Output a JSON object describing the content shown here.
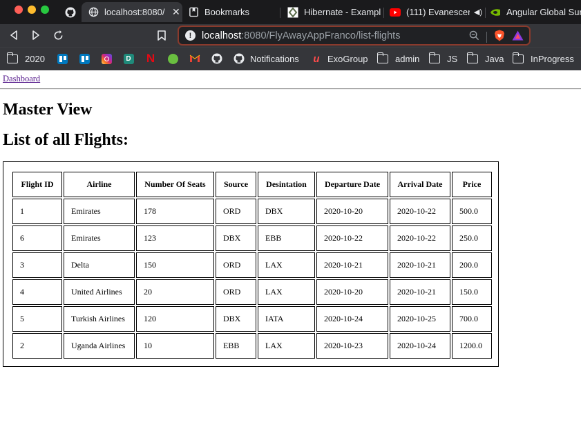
{
  "browser": {
    "tabs": [
      {
        "label": "",
        "icon": "github-icon"
      },
      {
        "label": "localhost:8080/",
        "icon": "globe-icon",
        "active": true
      },
      {
        "label": "Bookmarks",
        "icon": "bookmarks-icon"
      },
      {
        "label": "Hibernate - Exampl",
        "icon": "hibernate-icon"
      },
      {
        "label": "(111) Evanescen",
        "icon": "youtube-icon"
      },
      {
        "label": "Angular Global Sur",
        "icon": "nvidia-icon"
      }
    ],
    "address": {
      "host": "localhost",
      "path": ":8080/FlyAwayAppFranco/list-flights"
    },
    "bookmarks": [
      {
        "label": "2020",
        "icon": "folder-icon"
      },
      {
        "label": "",
        "icon": "trello-icon"
      },
      {
        "label": "",
        "icon": "trello-icon"
      },
      {
        "label": "",
        "icon": "instagram-icon"
      },
      {
        "label": "",
        "icon": "dailydev-icon"
      },
      {
        "label": "",
        "icon": "netflix-icon"
      },
      {
        "label": "",
        "icon": "green-app-icon"
      },
      {
        "label": "",
        "icon": "gmail-icon"
      },
      {
        "label": "",
        "icon": "github-icon"
      },
      {
        "label": "Notifications",
        "icon": "github-icon"
      },
      {
        "label": "ExoGroup",
        "icon": "exogroup-icon"
      },
      {
        "label": "admin",
        "icon": "folder-icon"
      },
      {
        "label": "JS",
        "icon": "folder-icon"
      },
      {
        "label": "Java",
        "icon": "folder-icon"
      },
      {
        "label": "InProgress",
        "icon": "folder-icon"
      }
    ]
  },
  "page": {
    "dashboard_link": "Dashboard",
    "heading": "Master View",
    "subheading": "List of all Flights:",
    "table": {
      "headers": [
        "Flight ID",
        "Airline",
        "Number Of Seats",
        "Source",
        "Desintation",
        "Departure Date",
        "Arrival Date",
        "Price"
      ],
      "rows": [
        [
          "1",
          "Emirates",
          "178",
          "ORD",
          "DBX",
          "2020-10-20",
          "2020-10-22",
          "500.0"
        ],
        [
          "6",
          "Emirates",
          "123",
          "DBX",
          "EBB",
          "2020-10-22",
          "2020-10-22",
          "250.0"
        ],
        [
          "3",
          "Delta",
          "150",
          "ORD",
          "LAX",
          "2020-10-21",
          "2020-10-21",
          "200.0"
        ],
        [
          "4",
          "United Airlines",
          "20",
          "ORD",
          "LAX",
          "2020-10-20",
          "2020-10-21",
          "150.0"
        ],
        [
          "5",
          "Turkish Airlines",
          "120",
          "DBX",
          "IATA",
          "2020-10-24",
          "2020-10-25",
          "700.0"
        ],
        [
          "2",
          "Uganda Airlines",
          "10",
          "EBB",
          "LAX",
          "2020-10-23",
          "2020-10-24",
          "1200.0"
        ]
      ]
    }
  },
  "colors": {
    "chrome_bg": "#35363a",
    "tabbar_bg": "#1a1a1c",
    "link_visited": "#551a8b",
    "omnibox_border": "#8a3a2c"
  }
}
